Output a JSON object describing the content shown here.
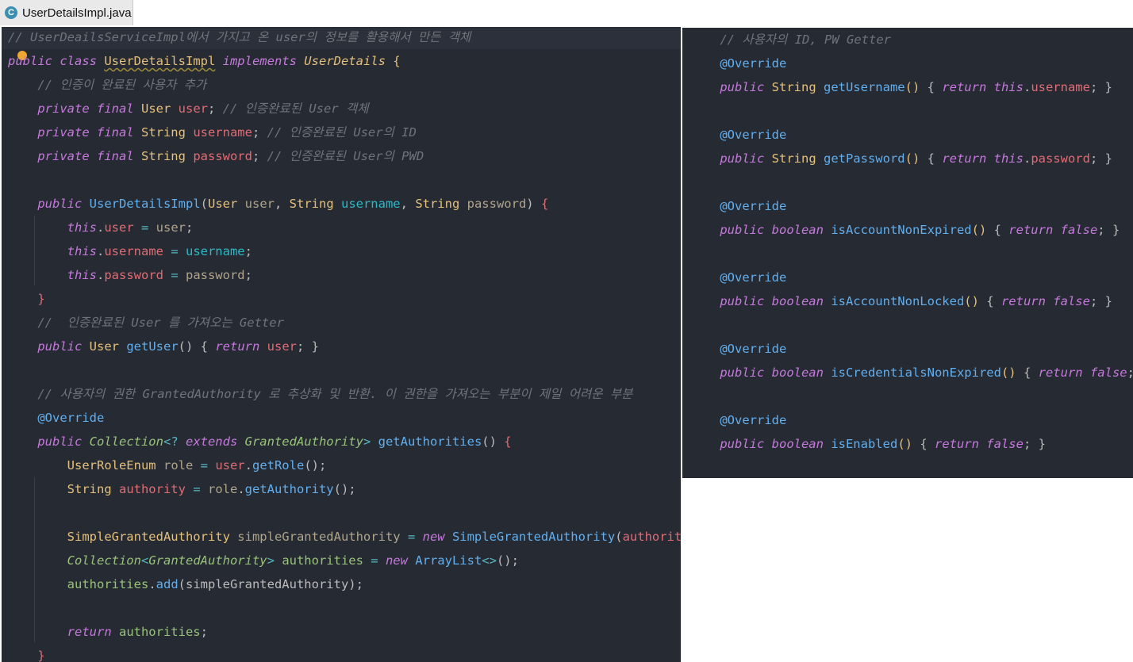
{
  "tab": {
    "icon_letter": "C",
    "title": "UserDetailsImpl.java"
  },
  "left": {
    "lines": [
      {
        "t": [
          {
            "c": "cm",
            "v": "// UserDeailsServiceImpl에서 가지고 온 user의 정보를 활용해서 만든 객체"
          }
        ]
      },
      {
        "t": [
          {
            "c": "kw",
            "v": "public class "
          },
          {
            "c": "ty sq",
            "v": "UserDetailsImpl"
          },
          {
            "c": "kw",
            "v": " implements "
          },
          {
            "c": "it",
            "v": "UserDetails"
          },
          {
            "c": "br",
            "v": " {"
          }
        ]
      },
      {
        "t": [
          {
            "c": "pu",
            "v": "    "
          },
          {
            "c": "cm",
            "v": "// 인증이 완료된 사용자 추가"
          }
        ]
      },
      {
        "t": [
          {
            "c": "pu",
            "v": "    "
          },
          {
            "c": "kw",
            "v": "private final "
          },
          {
            "c": "ty",
            "v": "User "
          },
          {
            "c": "fld",
            "v": "user"
          },
          {
            "c": "pu",
            "v": "; "
          },
          {
            "c": "cm",
            "v": "// 인증완료된 User 객체"
          }
        ]
      },
      {
        "t": [
          {
            "c": "pu",
            "v": "    "
          },
          {
            "c": "kw",
            "v": "private final "
          },
          {
            "c": "ty",
            "v": "String "
          },
          {
            "c": "fld",
            "v": "username"
          },
          {
            "c": "pu",
            "v": "; "
          },
          {
            "c": "cm",
            "v": "// 인증완료된 User의 ID"
          }
        ]
      },
      {
        "t": [
          {
            "c": "pu",
            "v": "    "
          },
          {
            "c": "kw",
            "v": "private final "
          },
          {
            "c": "ty",
            "v": "String "
          },
          {
            "c": "fld",
            "v": "password"
          },
          {
            "c": "pu",
            "v": "; "
          },
          {
            "c": "cm",
            "v": "// 인증완료된 User의 PWD"
          }
        ]
      },
      {
        "t": []
      },
      {
        "t": [
          {
            "c": "pu",
            "v": "    "
          },
          {
            "c": "kw",
            "v": "public "
          },
          {
            "c": "fn",
            "v": "UserDetailsImpl"
          },
          {
            "c": "pu",
            "v": "("
          },
          {
            "c": "ty",
            "v": "User "
          },
          {
            "c": "prm2",
            "v": "user"
          },
          {
            "c": "pu",
            "v": ", "
          },
          {
            "c": "ty",
            "v": "String "
          },
          {
            "c": "prm",
            "v": "username"
          },
          {
            "c": "pu",
            "v": ", "
          },
          {
            "c": "ty",
            "v": "String "
          },
          {
            "c": "prm2",
            "v": "password"
          },
          {
            "c": "pu",
            "v": ") "
          },
          {
            "c": "fld",
            "v": "{"
          }
        ]
      },
      {
        "t": [
          {
            "c": "pu",
            "v": "        "
          },
          {
            "c": "kw",
            "v": "this"
          },
          {
            "c": "pu",
            "v": "."
          },
          {
            "c": "fld",
            "v": "user"
          },
          {
            "c": "op",
            "v": " = "
          },
          {
            "c": "prm2",
            "v": "user"
          },
          {
            "c": "pu",
            "v": ";"
          }
        ]
      },
      {
        "t": [
          {
            "c": "pu",
            "v": "        "
          },
          {
            "c": "kw",
            "v": "this"
          },
          {
            "c": "pu",
            "v": "."
          },
          {
            "c": "fld",
            "v": "username"
          },
          {
            "c": "op",
            "v": " = "
          },
          {
            "c": "prm",
            "v": "username"
          },
          {
            "c": "pu",
            "v": ";"
          }
        ]
      },
      {
        "t": [
          {
            "c": "pu",
            "v": "        "
          },
          {
            "c": "kw",
            "v": "this"
          },
          {
            "c": "pu",
            "v": "."
          },
          {
            "c": "fld",
            "v": "password"
          },
          {
            "c": "op",
            "v": " = "
          },
          {
            "c": "prm2",
            "v": "password"
          },
          {
            "c": "pu",
            "v": ";"
          }
        ]
      },
      {
        "t": [
          {
            "c": "pu",
            "v": "    "
          },
          {
            "c": "fld",
            "v": "}"
          }
        ]
      },
      {
        "t": [
          {
            "c": "pu",
            "v": "    "
          },
          {
            "c": "cm",
            "v": "//  인증완료된 User 를 가져오는 Getter"
          }
        ]
      },
      {
        "t": [
          {
            "c": "pu",
            "v": "    "
          },
          {
            "c": "kw",
            "v": "public "
          },
          {
            "c": "ty",
            "v": "User "
          },
          {
            "c": "fn",
            "v": "getUser"
          },
          {
            "c": "pu",
            "v": "() { "
          },
          {
            "c": "kw",
            "v": "return "
          },
          {
            "c": "fld",
            "v": "user"
          },
          {
            "c": "pu",
            "v": "; }"
          }
        ]
      },
      {
        "t": []
      },
      {
        "t": [
          {
            "c": "pu",
            "v": "    "
          },
          {
            "c": "cm",
            "v": "// 사용자의 권한 GrantedAuthority 로 추상화 및 반환. 이 권한을 가져오는 부분이 제일 어려운 부분"
          }
        ]
      },
      {
        "t": [
          {
            "c": "pu",
            "v": "    "
          },
          {
            "c": "an",
            "v": "@Override"
          }
        ]
      },
      {
        "t": [
          {
            "c": "pu",
            "v": "    "
          },
          {
            "c": "kw",
            "v": "public "
          },
          {
            "c": "it2",
            "v": "Collection"
          },
          {
            "c": "op",
            "v": "<? "
          },
          {
            "c": "kw",
            "v": "extends "
          },
          {
            "c": "it2",
            "v": "GrantedAuthority"
          },
          {
            "c": "op",
            "v": "> "
          },
          {
            "c": "fn",
            "v": "getAuthorities"
          },
          {
            "c": "pu",
            "v": "() "
          },
          {
            "c": "fld",
            "v": "{"
          }
        ]
      },
      {
        "t": [
          {
            "c": "pu",
            "v": "        "
          },
          {
            "c": "ty",
            "v": "UserRoleEnum "
          },
          {
            "c": "prm2",
            "v": "role"
          },
          {
            "c": "op",
            "v": " = "
          },
          {
            "c": "fld",
            "v": "user"
          },
          {
            "c": "pu",
            "v": "."
          },
          {
            "c": "fn",
            "v": "getRole"
          },
          {
            "c": "pu",
            "v": "();"
          }
        ]
      },
      {
        "t": [
          {
            "c": "pu",
            "v": "        "
          },
          {
            "c": "ty",
            "v": "String "
          },
          {
            "c": "fld",
            "v": "authority"
          },
          {
            "c": "op",
            "v": " = "
          },
          {
            "c": "prm2",
            "v": "role"
          },
          {
            "c": "pu",
            "v": "."
          },
          {
            "c": "fn",
            "v": "getAuthority"
          },
          {
            "c": "pu",
            "v": "();"
          }
        ]
      },
      {
        "t": []
      },
      {
        "t": [
          {
            "c": "pu",
            "v": "        "
          },
          {
            "c": "ty",
            "v": "SimpleGrantedAuthority "
          },
          {
            "c": "prm2",
            "v": "simpleGrantedAuthority"
          },
          {
            "c": "op",
            "v": " = "
          },
          {
            "c": "kw",
            "v": "new "
          },
          {
            "c": "fn",
            "v": "SimpleGrantedAuthority"
          },
          {
            "c": "pu",
            "v": "("
          },
          {
            "c": "fld",
            "v": "authority"
          },
          {
            "c": "pu",
            "v": ");"
          }
        ]
      },
      {
        "t": [
          {
            "c": "pu",
            "v": "        "
          },
          {
            "c": "it2",
            "v": "Collection"
          },
          {
            "c": "op",
            "v": "<"
          },
          {
            "c": "it2",
            "v": "GrantedAuthority"
          },
          {
            "c": "op",
            "v": "> "
          },
          {
            "c": "lv",
            "v": "authorities"
          },
          {
            "c": "op",
            "v": " = "
          },
          {
            "c": "kw",
            "v": "new "
          },
          {
            "c": "fn",
            "v": "ArrayList"
          },
          {
            "c": "op",
            "v": "<>"
          },
          {
            "c": "pu",
            "v": "();"
          }
        ]
      },
      {
        "t": [
          {
            "c": "pu",
            "v": "        "
          },
          {
            "c": "lv",
            "v": "authorities"
          },
          {
            "c": "pu",
            "v": "."
          },
          {
            "c": "fn",
            "v": "add"
          },
          {
            "c": "pu",
            "v": "(simpleGrantedAuthority);"
          }
        ]
      },
      {
        "t": []
      },
      {
        "t": [
          {
            "c": "pu",
            "v": "        "
          },
          {
            "c": "kw",
            "v": "return "
          },
          {
            "c": "lv",
            "v": "authorities"
          },
          {
            "c": "pu",
            "v": ";"
          }
        ]
      },
      {
        "t": [
          {
            "c": "pu",
            "v": "    "
          },
          {
            "c": "fld",
            "v": "}"
          }
        ]
      }
    ]
  },
  "right": {
    "lines": [
      {
        "t": [
          {
            "c": "pu",
            "v": "    "
          },
          {
            "c": "cm",
            "v": "// 사용자의 ID, PW Getter"
          }
        ]
      },
      {
        "t": [
          {
            "c": "pu",
            "v": "    "
          },
          {
            "c": "an",
            "v": "@Override"
          }
        ]
      },
      {
        "t": [
          {
            "c": "pu",
            "v": "    "
          },
          {
            "c": "kw",
            "v": "public "
          },
          {
            "c": "ty",
            "v": "String "
          },
          {
            "c": "fn",
            "v": "getUsername"
          },
          {
            "c": "br",
            "v": "()"
          },
          {
            "c": "pu",
            "v": " { "
          },
          {
            "c": "kw",
            "v": "return this"
          },
          {
            "c": "pu",
            "v": "."
          },
          {
            "c": "fld",
            "v": "username"
          },
          {
            "c": "pu",
            "v": "; }"
          }
        ]
      },
      {
        "t": []
      },
      {
        "t": [
          {
            "c": "pu",
            "v": "    "
          },
          {
            "c": "an",
            "v": "@Override"
          }
        ]
      },
      {
        "t": [
          {
            "c": "pu",
            "v": "    "
          },
          {
            "c": "kw",
            "v": "public "
          },
          {
            "c": "ty",
            "v": "String "
          },
          {
            "c": "fn",
            "v": "getPassword"
          },
          {
            "c": "br",
            "v": "()"
          },
          {
            "c": "pu",
            "v": " { "
          },
          {
            "c": "kw",
            "v": "return this"
          },
          {
            "c": "pu",
            "v": "."
          },
          {
            "c": "fld",
            "v": "password"
          },
          {
            "c": "pu",
            "v": "; }"
          }
        ]
      },
      {
        "t": []
      },
      {
        "t": [
          {
            "c": "pu",
            "v": "    "
          },
          {
            "c": "an",
            "v": "@Override"
          }
        ]
      },
      {
        "t": [
          {
            "c": "pu",
            "v": "    "
          },
          {
            "c": "kw",
            "v": "public boolean "
          },
          {
            "c": "fn",
            "v": "isAccountNonExpired"
          },
          {
            "c": "br",
            "v": "()"
          },
          {
            "c": "pu",
            "v": " { "
          },
          {
            "c": "kw",
            "v": "return false"
          },
          {
            "c": "pu",
            "v": "; }"
          }
        ]
      },
      {
        "t": []
      },
      {
        "t": [
          {
            "c": "pu",
            "v": "    "
          },
          {
            "c": "an",
            "v": "@Override"
          }
        ]
      },
      {
        "t": [
          {
            "c": "pu",
            "v": "    "
          },
          {
            "c": "kw",
            "v": "public boolean "
          },
          {
            "c": "fn",
            "v": "isAccountNonLocked"
          },
          {
            "c": "br",
            "v": "()"
          },
          {
            "c": "pu",
            "v": " { "
          },
          {
            "c": "kw",
            "v": "return false"
          },
          {
            "c": "pu",
            "v": "; }"
          }
        ]
      },
      {
        "t": []
      },
      {
        "t": [
          {
            "c": "pu",
            "v": "    "
          },
          {
            "c": "an",
            "v": "@Override"
          }
        ]
      },
      {
        "t": [
          {
            "c": "pu",
            "v": "    "
          },
          {
            "c": "kw",
            "v": "public boolean "
          },
          {
            "c": "fn",
            "v": "isCredentialsNonExpired"
          },
          {
            "c": "br",
            "v": "()"
          },
          {
            "c": "pu",
            "v": " { "
          },
          {
            "c": "kw",
            "v": "return false"
          },
          {
            "c": "pu",
            "v": "; }"
          }
        ]
      },
      {
        "t": []
      },
      {
        "t": [
          {
            "c": "pu",
            "v": "    "
          },
          {
            "c": "an",
            "v": "@Override"
          }
        ]
      },
      {
        "t": [
          {
            "c": "pu",
            "v": "    "
          },
          {
            "c": "kw",
            "v": "public boolean "
          },
          {
            "c": "fn",
            "v": "isEnabled"
          },
          {
            "c": "br",
            "v": "()"
          },
          {
            "c": "pu",
            "v": " { "
          },
          {
            "c": "kw",
            "v": "return false"
          },
          {
            "c": "pu",
            "v": "; }"
          }
        ]
      },
      {
        "t": []
      },
      {
        "t": [
          {
            "c": "br",
            "v": "}"
          }
        ]
      }
    ]
  }
}
